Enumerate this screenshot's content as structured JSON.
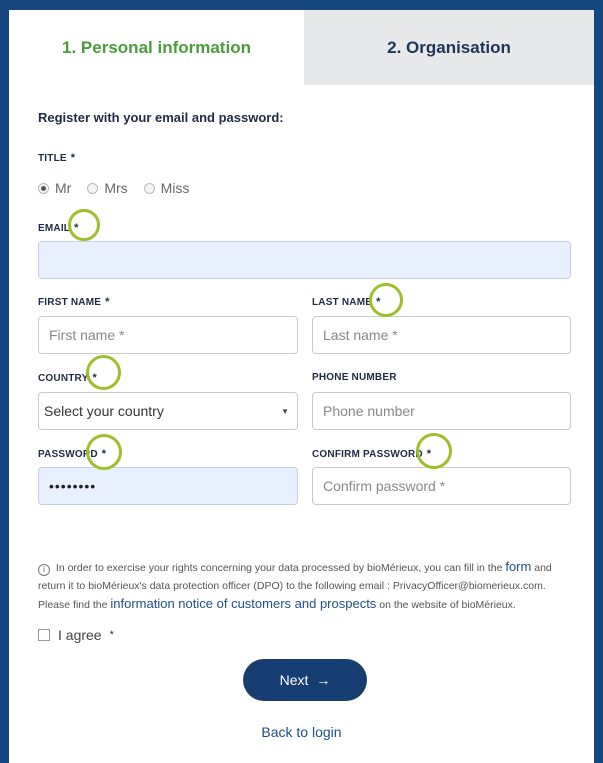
{
  "tabs": [
    {
      "label": "1. Personal information",
      "active": true
    },
    {
      "label": "2. Organisation",
      "active": false
    }
  ],
  "intro": "Register with your email and password:",
  "required_mark": "*",
  "title_field": {
    "label": "TITLE",
    "options": [
      "Mr",
      "Mrs",
      "Miss"
    ],
    "selected": "Mr"
  },
  "email": {
    "label": "EMAIL",
    "value": ""
  },
  "first_name": {
    "label": "FIRST NAME",
    "placeholder": "First name *"
  },
  "last_name": {
    "label": "LAST NAME",
    "placeholder": "Last name *"
  },
  "country": {
    "label": "COUNTRY",
    "selected": "Select your country"
  },
  "phone": {
    "label": "PHONE NUMBER",
    "placeholder": "Phone number"
  },
  "password": {
    "label": "PASSWORD",
    "value": "••••••••"
  },
  "confirm_password": {
    "label": "CONFIRM PASSWORD",
    "placeholder": "Confirm password *"
  },
  "notice": {
    "part1": "In order to exercise your rights concerning your data processed by bioMérieux, you can fill in the",
    "form_link": "form",
    "part2": "and return it to bioMérieux's data protection officer (DPO) to the following email : PrivacyOfficer@biomerieux.com. Please find the",
    "info_link": "information notice of customers and prospects",
    "part3": "on the website of bioMérieux."
  },
  "agree_label": "I agree",
  "next_label": "Next",
  "back_label": "Back to login",
  "colors": {
    "frame": "#17477f",
    "active_tab_text": "#4a9d3a",
    "ring": "#9cbf2b",
    "button": "#163e73"
  }
}
